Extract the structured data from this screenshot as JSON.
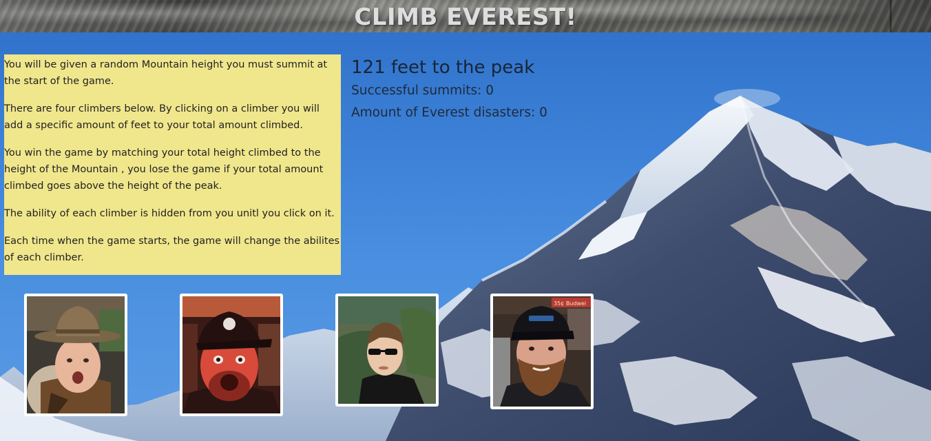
{
  "header": {
    "title": "CLIMB EVEREST!"
  },
  "instructions": [
    "You will be given a random Mountain height you must summit at the start of the game.",
    "There are four climbers below. By clicking on a climber you will add a specific amount of feet to your total amount climbed.",
    "You win the game by matching your total height climbed to the height of the Mountain , you lose the game if your total amount climbed goes above the height of the peak.",
    "The ability of each climber is hidden from you unitl you click on it.",
    "Each time when the game starts, the game will change the abilites of each climber."
  ],
  "stats": {
    "peak_text": "121 feet to the peak",
    "summits_text": "Successful summits: 0",
    "disasters_text": "Amount of Everest disasters: 0"
  },
  "climbers": [
    {
      "name": "climber-1-photo",
      "icon": "man-with-cowboy-hat"
    },
    {
      "name": "climber-2-photo",
      "icon": "man-with-cap-red-light"
    },
    {
      "name": "climber-3-photo",
      "icon": "man-with-sunglasses"
    },
    {
      "name": "climber-4-photo",
      "icon": "man-with-beard-and-cap",
      "sign_text": "35¢ Budwei"
    }
  ],
  "colors": {
    "sky": "#3d82d8",
    "panel": "#f0e68c",
    "header_rock": "#6b6b69",
    "text": "#1c2a3a"
  }
}
